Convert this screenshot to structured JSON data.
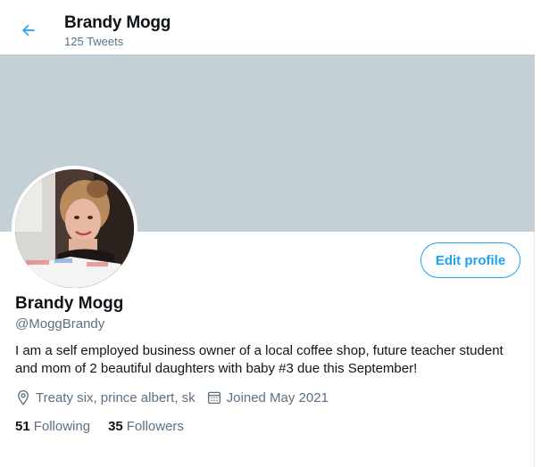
{
  "header": {
    "name": "Brandy Mogg",
    "tweet_count": "125 Tweets",
    "back_icon": "arrow-left-icon"
  },
  "colors": {
    "accent": "#1da1f2",
    "banner": "#c4cfd6",
    "secondary_text": "#5b7083"
  },
  "profile": {
    "name": "Brandy Mogg",
    "handle": "@MoggBrandy",
    "bio": "I am a self employed business owner of a local coffee shop, future teacher student and mom of 2 beautiful daughters with baby #3 due this September!",
    "location": "Treaty six, prince albert, sk",
    "joined": "Joined May 2021",
    "edit_button": "Edit profile"
  },
  "stats": {
    "following_count": "51",
    "following_label": "Following",
    "followers_count": "35",
    "followers_label": "Followers"
  },
  "icons": {
    "location": "location-pin-icon",
    "joined": "calendar-icon"
  }
}
